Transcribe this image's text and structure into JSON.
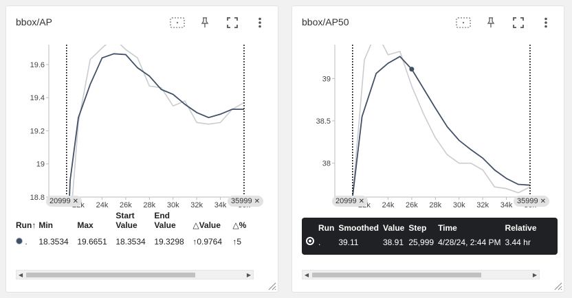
{
  "colors": {
    "smoothed": "#425066",
    "raw": "#c9ccd1",
    "accent": "#425066"
  },
  "cards": [
    {
      "title": "bbox/AP",
      "toolbar": {
        "icons": [
          "fit-domain-icon",
          "pin-icon",
          "fullscreen-icon",
          "more-vert-icon"
        ]
      },
      "range_chips": {
        "start": "20999",
        "end": "35999"
      },
      "table": {
        "headers": [
          "Run",
          "Min",
          "Max",
          "Start Value",
          "End Value",
          "Value",
          "%"
        ],
        "sort_indicator": "↑",
        "delta_symbol": "△",
        "row": {
          "run": ".",
          "min": "18.3534",
          "max": "19.6651",
          "start": "18.3534",
          "end": "19.3298",
          "value": "↑0.9764",
          "pct": "↑5"
        }
      }
    },
    {
      "title": "bbox/AP50",
      "toolbar": {
        "icons": [
          "fit-domain-icon",
          "pin-icon",
          "fullscreen-icon",
          "more-vert-icon"
        ]
      },
      "range_chips": {
        "start": "20999",
        "end": "35999"
      },
      "tooltip": {
        "headers": [
          "Run",
          "Smoothed",
          "Value",
          "Step",
          "Time",
          "Relative"
        ],
        "row": {
          "run": ".",
          "smoothed": "39.11",
          "value": "38.91",
          "step": "25,999",
          "time": "4/28/24, 2:44 PM",
          "relative": "3.44 hr"
        }
      }
    }
  ],
  "chart_data": [
    {
      "type": "line",
      "x_tick_labels": [
        "22k",
        "24k",
        "26k",
        "28k",
        "30k",
        "32k",
        "34k",
        "36k"
      ],
      "y_tick_labels": [
        "18.8",
        "19",
        "19.2",
        "19.4",
        "19.6"
      ],
      "xlim": [
        19500,
        36000
      ],
      "ylim": [
        18.8,
        19.72
      ],
      "series": [
        {
          "x": [
            21000,
            22000,
            23000,
            24000,
            25000,
            26000,
            27000,
            28000,
            29000,
            30000,
            31000,
            32000,
            33000,
            34000,
            35000,
            36000
          ],
          "values": [
            18.35,
            19.25,
            19.63,
            19.7,
            19.76,
            19.69,
            19.64,
            19.47,
            19.46,
            19.35,
            19.38,
            19.25,
            19.24,
            19.25,
            19.33,
            19.37
          ],
          "style": "raw"
        },
        {
          "x": [
            21000,
            21300,
            22000,
            23000,
            24000,
            25000,
            26000,
            27000,
            28000,
            29000,
            30000,
            31000,
            32000,
            33000,
            34000,
            35000,
            36000
          ],
          "values": [
            18.35,
            18.9,
            19.28,
            19.48,
            19.64,
            19.665,
            19.66,
            19.58,
            19.53,
            19.45,
            19.42,
            19.36,
            19.31,
            19.28,
            19.3,
            19.33,
            19.33
          ],
          "style": "smoothed"
        }
      ],
      "range_markers": [
        20999,
        35999
      ]
    },
    {
      "type": "line",
      "x_tick_labels": [
        "22k",
        "24k",
        "26k",
        "28k",
        "30k",
        "32k",
        "34k",
        "36k"
      ],
      "y_tick_labels": [
        "38",
        "38.5",
        "39"
      ],
      "xlim": [
        19500,
        36000
      ],
      "ylim": [
        37.6,
        39.4
      ],
      "series": [
        {
          "x": [
            21000,
            22000,
            23000,
            24000,
            25000,
            26000,
            27000,
            28000,
            29000,
            30000,
            31000,
            32000,
            33000,
            34000,
            35000,
            36000
          ],
          "values": [
            37.6,
            39.22,
            39.55,
            39.28,
            39.32,
            38.91,
            38.58,
            38.3,
            38.1,
            38.0,
            38.0,
            37.92,
            37.72,
            37.7,
            37.65,
            37.72
          ],
          "style": "raw"
        },
        {
          "x": [
            21000,
            21800,
            23000,
            24000,
            25000,
            26000,
            27000,
            28000,
            29000,
            30000,
            31000,
            32000,
            33000,
            34000,
            35000,
            36000
          ],
          "values": [
            37.6,
            38.55,
            39.06,
            39.18,
            39.26,
            39.11,
            38.88,
            38.65,
            38.43,
            38.27,
            38.16,
            38.06,
            37.92,
            37.82,
            37.75,
            37.74
          ],
          "style": "smoothed"
        }
      ],
      "range_markers": [
        20999,
        35999
      ],
      "hover_point": {
        "x": 25999,
        "y": 39.11
      }
    }
  ]
}
